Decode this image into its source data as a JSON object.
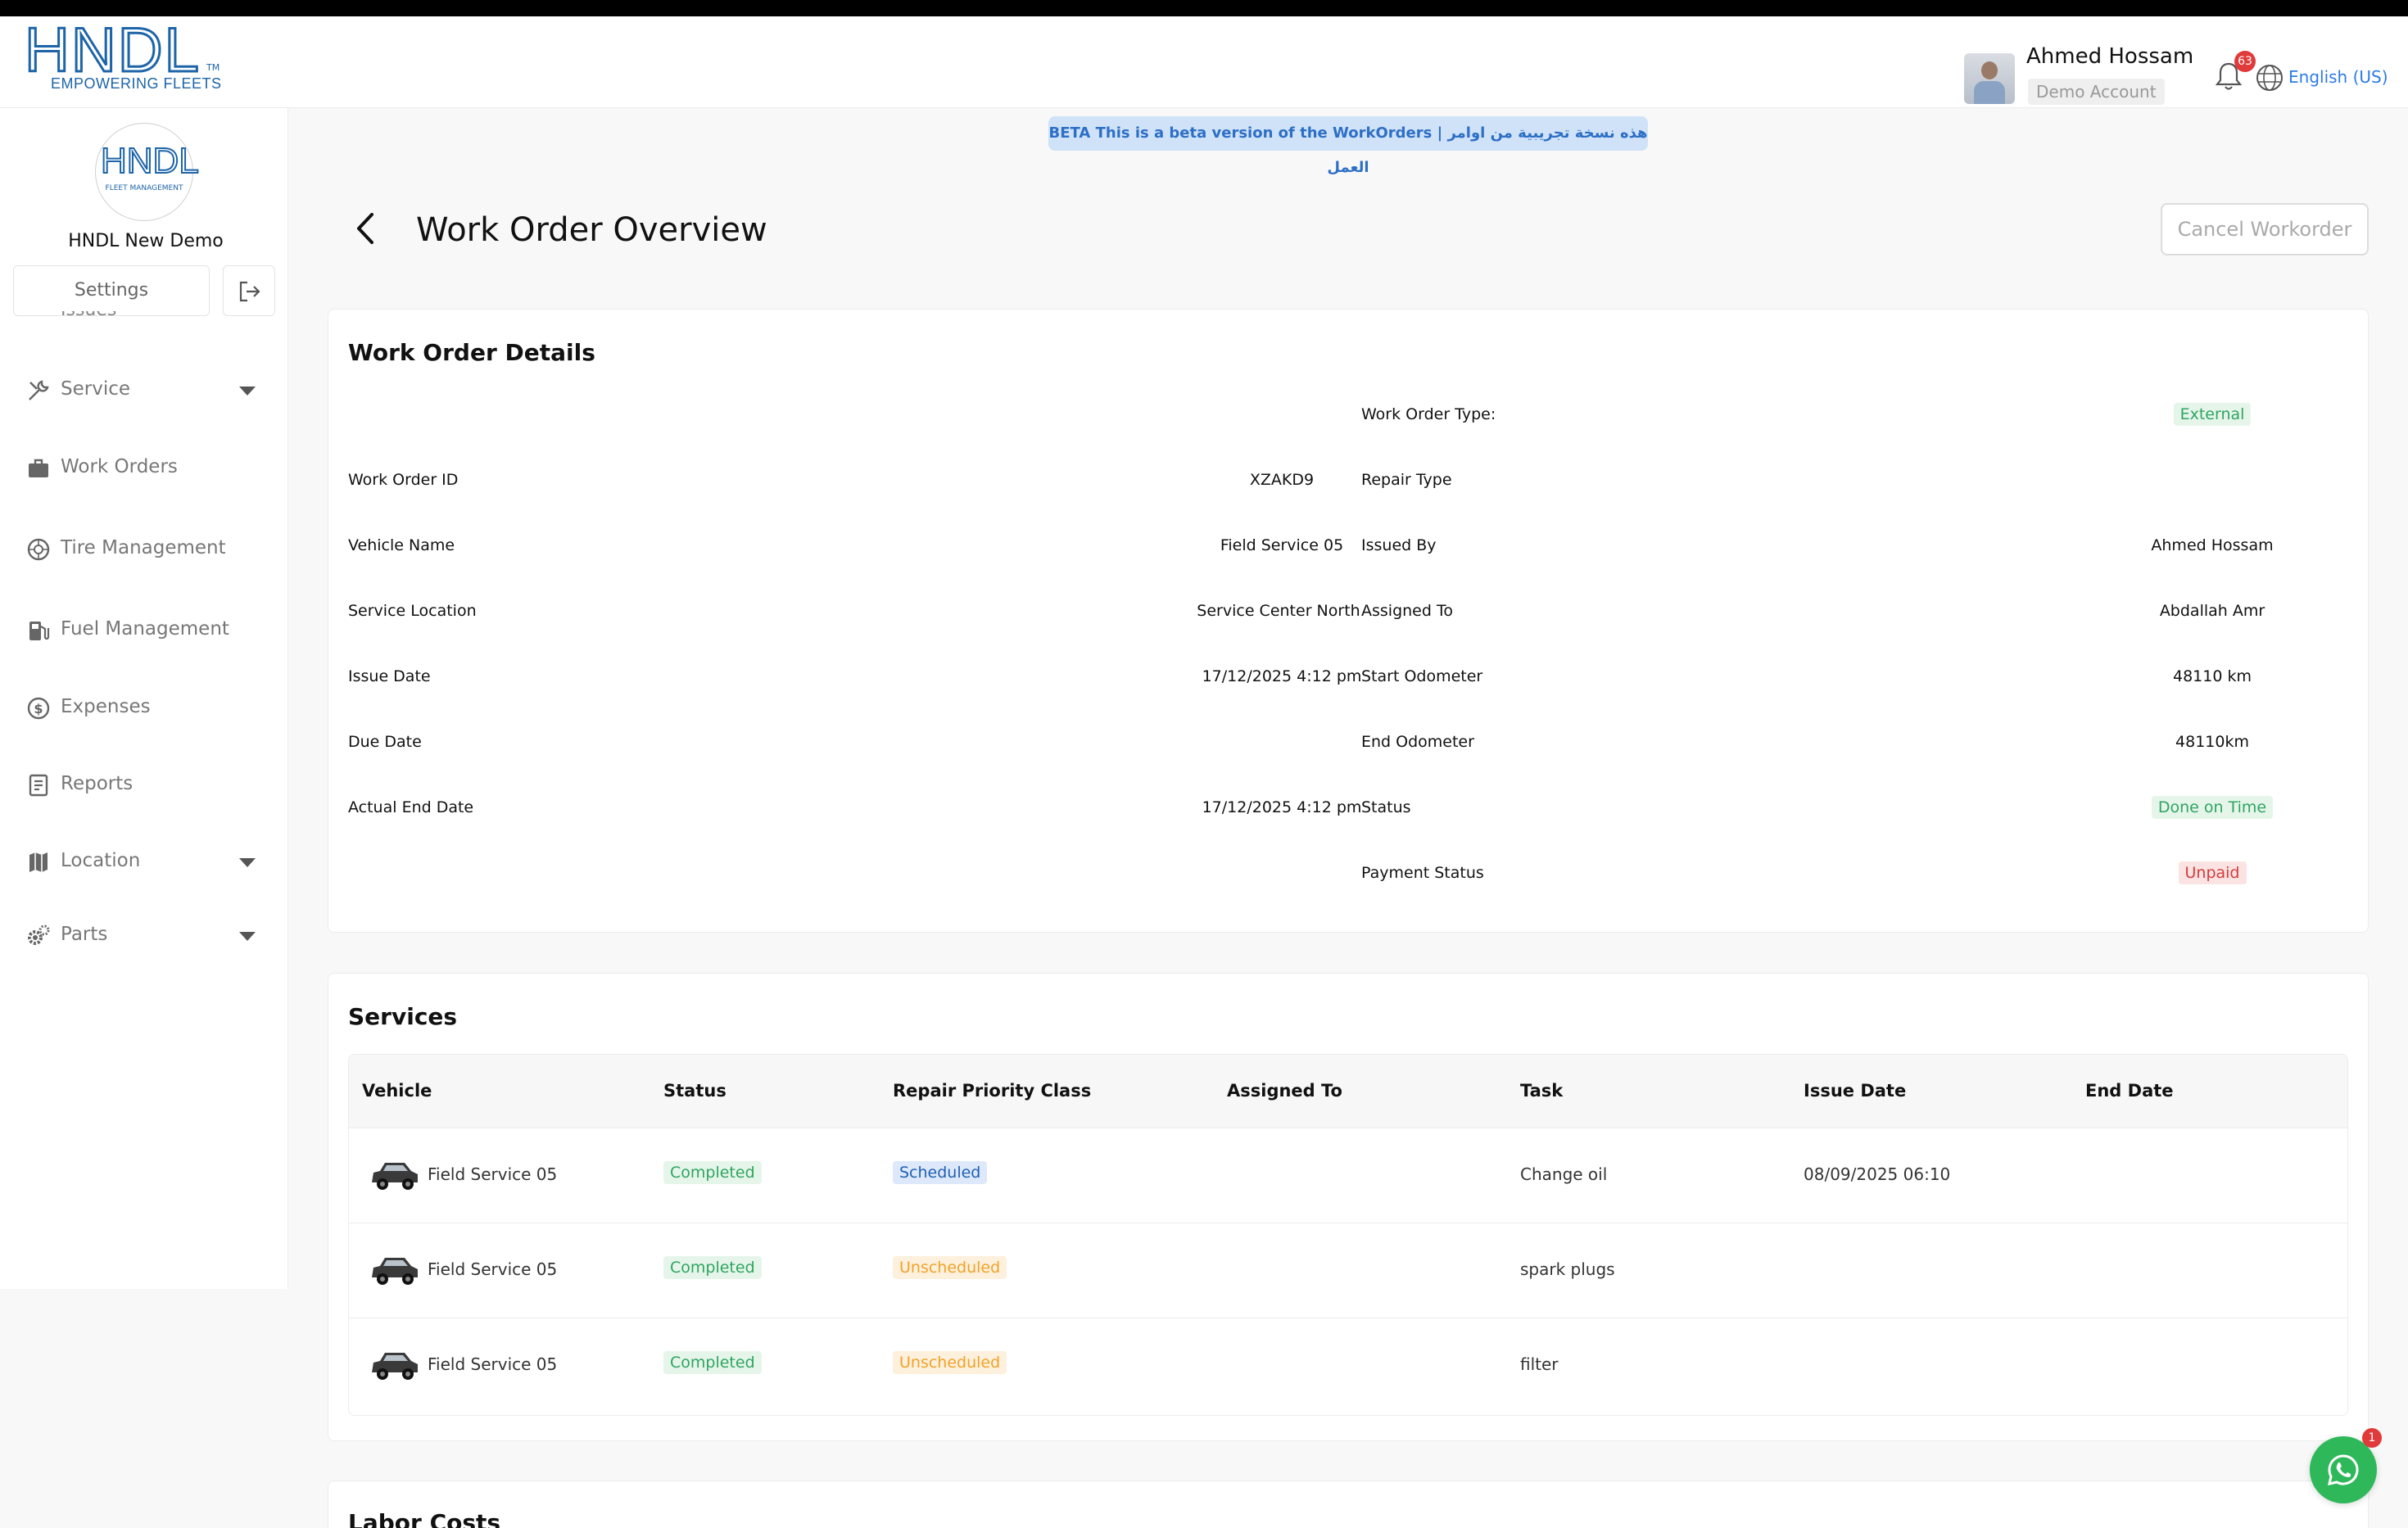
{
  "brand": {
    "name": "HNDL",
    "tm": "TM",
    "tagline": "EMPOWERING FLEETS"
  },
  "header": {
    "user_name": "Ahmed Hossam",
    "account": "Demo Account",
    "notifications": "63",
    "language": "English (US)"
  },
  "sidebar": {
    "org_logo_text": "HNDL",
    "org_logo_sub": "FLEET MANAGEMENT",
    "org_name": "HNDL New Demo",
    "settings_label": "Settings",
    "cut_item_label": "Issues",
    "items": [
      {
        "label": "Service",
        "icon": "wrench-icon",
        "expandable": true
      },
      {
        "label": "Work Orders",
        "icon": "briefcase-icon",
        "expandable": false
      },
      {
        "label": "Tire Management",
        "icon": "tire-icon",
        "expandable": false
      },
      {
        "label": "Fuel Management",
        "icon": "fuel-pump-icon",
        "expandable": false
      },
      {
        "label": "Expenses",
        "icon": "dollar-circle-icon",
        "expandable": false
      },
      {
        "label": "Reports",
        "icon": "report-icon",
        "expandable": false
      },
      {
        "label": "Location",
        "icon": "map-icon",
        "expandable": true
      },
      {
        "label": "Parts",
        "icon": "gears-icon",
        "expandable": true
      }
    ]
  },
  "beta_banner": "BETA This is a beta version of the WorkOrders | هذه نسخة تجريبية من اوامر العمل",
  "page": {
    "title": "Work Order Overview",
    "cancel_label": "Cancel Workorder"
  },
  "details": {
    "title": "Work Order Details",
    "left": [
      {
        "label": "Work Order ID",
        "value": "XZAKD9"
      },
      {
        "label": "Vehicle Name",
        "value": "Field Service 05"
      },
      {
        "label": "Service Location",
        "value": "Service Center North"
      },
      {
        "label": "Issue Date",
        "value": "17/12/2025 4:12 pm"
      },
      {
        "label": "Due Date",
        "value": ""
      },
      {
        "label": "Actual End Date",
        "value": "17/12/2025 4:12 pm"
      }
    ],
    "right": [
      {
        "label": "Work Order Type:",
        "value": "External"
      },
      {
        "label": "Repair Type",
        "value": ""
      },
      {
        "label": "Issued By",
        "value": "Ahmed Hossam"
      },
      {
        "label": "Assigned To",
        "value": "Abdallah Amr"
      },
      {
        "label": "Start Odometer",
        "value": "48110 km"
      },
      {
        "label": "End Odometer",
        "value": "48110km"
      },
      {
        "label": "Status",
        "value": "Done on Time"
      },
      {
        "label": "Payment Status",
        "value": "Unpaid"
      }
    ]
  },
  "services": {
    "title": "Services",
    "columns": [
      "Vehicle",
      "Status",
      "Repair Priority Class",
      "Assigned To",
      "Task",
      "Issue Date",
      "End Date"
    ],
    "rows": [
      {
        "vehicle": "Field Service 05",
        "status": "Completed",
        "priority": "Scheduled",
        "assigned": "",
        "task": "Change oil",
        "issue_date": "08/09/2025 06:10",
        "end_date": ""
      },
      {
        "vehicle": "Field Service 05",
        "status": "Completed",
        "priority": "Unscheduled",
        "assigned": "",
        "task": "spark plugs",
        "issue_date": "",
        "end_date": ""
      },
      {
        "vehicle": "Field Service 05",
        "status": "Completed",
        "priority": "Unscheduled",
        "assigned": "",
        "task": "filter",
        "issue_date": "",
        "end_date": ""
      }
    ]
  },
  "labor": {
    "title": "Labor Costs"
  },
  "chat": {
    "badge": "1"
  },
  "colors": {
    "brand_blue": "#1d64a8",
    "accent_blue": "#2d7be5",
    "success": "#2fa561",
    "danger": "#d43b3b",
    "warning": "#f0a32a",
    "whatsapp": "#2fb85a"
  }
}
